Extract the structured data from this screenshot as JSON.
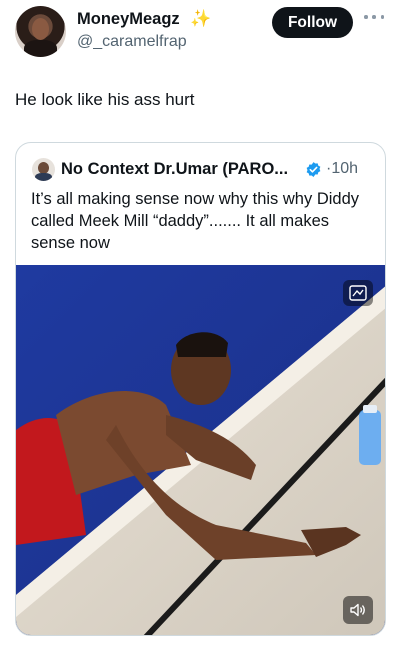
{
  "author": {
    "display_name": "MoneyMeagz",
    "handle": "@_caramelfrap",
    "badge_icon": "sparkles-icon"
  },
  "actions": {
    "follow_label": "Follow",
    "more_icon": "more-horizontal-icon"
  },
  "tweet": {
    "text": "He look like his ass hurt"
  },
  "quoted_tweet": {
    "display_name": "No Context Dr.Umar (PARO...",
    "verified_icon": "verified-badge-icon",
    "time": "·10h",
    "text": "It’s all making sense now why this why Diddy called Meek Mill “daddy”....... It all makes sense now",
    "media": {
      "gif_icon": "gif-icon",
      "sound_icon": "volume-muted-icon"
    }
  },
  "colors": {
    "text_primary": "#0f1419",
    "text_secondary": "#536471",
    "border": "#cfd9de",
    "verified_blue": "#1d9bf0",
    "pool_blue": "#2340a8"
  }
}
